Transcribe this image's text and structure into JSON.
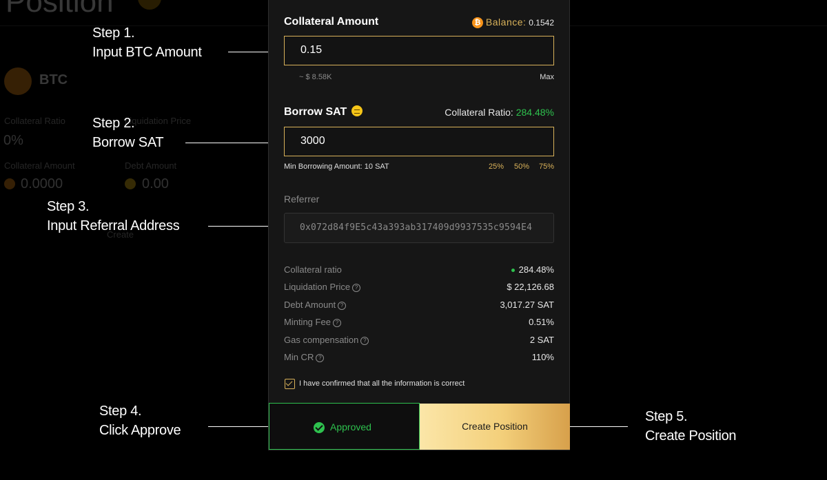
{
  "background": {
    "title": "Position",
    "asset": "BTC",
    "collateral_ratio_label": "Collateral Ratio",
    "collateral_ratio_value": "0%",
    "liquidation_price_label": "Liquidation Price",
    "collateral_amount_label": "Collateral Amount",
    "collateral_amount_value": "0.0000",
    "debt_amount_label": "Debt Amount",
    "debt_amount_value": "0.00",
    "create_label": "Create"
  },
  "steps": [
    {
      "line1": "Step 1.",
      "line2": "Input BTC Amount"
    },
    {
      "line1": "Step 2.",
      "line2": "Borrow SAT"
    },
    {
      "line1": "Step 3.",
      "line2": "Input Referral Address"
    },
    {
      "line1": "Step 4.",
      "line2": "Click Approve"
    },
    {
      "line1": "Step 5.",
      "line2": "Create Position"
    }
  ],
  "collateral": {
    "label": "Collateral Amount",
    "balance_label": "Balance:",
    "balance_value": "0.1542",
    "input_value": "0.15",
    "usd_value": "~ $ 8.58K",
    "max_label": "Max",
    "icon": "btc-coin-icon"
  },
  "borrow": {
    "label": "Borrow SAT",
    "ratio_label": "Collateral Ratio:",
    "ratio_value": "284.48%",
    "input_value": "3000",
    "min_label": "Min Borrowing Amount: 10 SAT",
    "pct_25": "25%",
    "pct_50": "50%",
    "pct_75": "75%",
    "icon": "sat-coin-icon"
  },
  "referrer": {
    "label": "Referrer",
    "value": "0x072d84f9E5c43a393ab317409d9937535c9594E4"
  },
  "summary": [
    {
      "label": "Collateral ratio",
      "value": "284.48%"
    },
    {
      "label": "Liquidation Price",
      "value": "$ 22,126.68"
    },
    {
      "label": "Debt Amount",
      "value": "3,017.27 SAT"
    },
    {
      "label": "Minting Fee",
      "value": "0.51%"
    },
    {
      "label": "Gas compensation",
      "value": "2 SAT"
    },
    {
      "label": "Min CR",
      "value": "110%"
    }
  ],
  "confirm_text": "I have confirmed that all the information is correct",
  "buttons": {
    "approved_label": "Approved",
    "create_label": "Create Position"
  },
  "colors": {
    "accent_gold": "#d9b25a",
    "positive_green": "#2ec14e",
    "btc_orange": "#f7931a"
  }
}
